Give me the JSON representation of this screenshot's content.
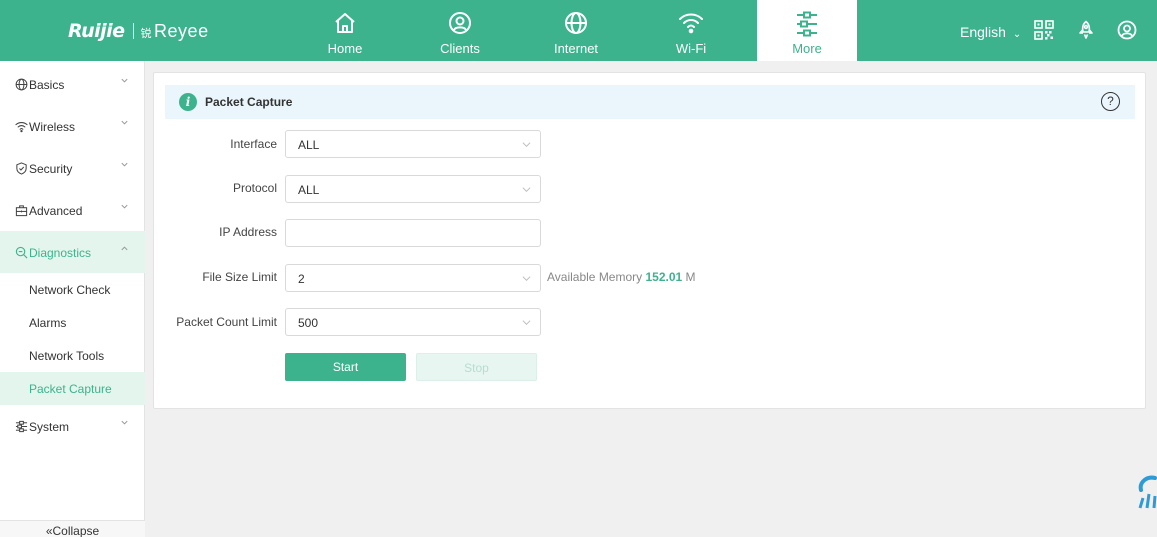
{
  "header": {
    "brand_primary": "Ruijie",
    "brand_secondary_mini": "锐",
    "brand_secondary": "Reyee",
    "nav": [
      {
        "label": "Home",
        "icon": "home-icon"
      },
      {
        "label": "Clients",
        "icon": "user-icon"
      },
      {
        "label": "Internet",
        "icon": "globe-icon"
      },
      {
        "label": "Wi-Fi",
        "icon": "wifi-icon"
      },
      {
        "label": "More",
        "icon": "sliders-icon",
        "active": true
      }
    ],
    "language": "English",
    "icons": [
      "qrcode-icon",
      "rocket-icon",
      "account-icon"
    ],
    "accent_color": "#3db38d"
  },
  "sidebar": {
    "groups": [
      {
        "label": "Basics",
        "icon": "globe-icon"
      },
      {
        "label": "Wireless",
        "icon": "wifi-icon"
      },
      {
        "label": "Security",
        "icon": "shield-icon"
      },
      {
        "label": "Advanced",
        "icon": "toolbox-icon"
      },
      {
        "label": "Diagnostics",
        "icon": "search-icon",
        "open": true
      },
      {
        "label": "System",
        "icon": "sliders-icon"
      }
    ],
    "diagnostics_items": [
      {
        "label": "Network Check"
      },
      {
        "label": "Alarms"
      },
      {
        "label": "Network Tools"
      },
      {
        "label": "Packet Capture",
        "active": true
      }
    ],
    "collapse_label": "«Collapse"
  },
  "main": {
    "title": "Packet Capture",
    "form": {
      "interface": {
        "label": "Interface",
        "value": "ALL"
      },
      "protocol": {
        "label": "Protocol",
        "value": "ALL"
      },
      "ip_address": {
        "label": "IP Address",
        "value": ""
      },
      "file_size_limit": {
        "label": "File Size Limit",
        "value": "2"
      },
      "packet_count_limit": {
        "label": "Packet Count Limit",
        "value": "500"
      }
    },
    "memory": {
      "prefix": "Available Memory",
      "value": "152.01",
      "unit": "M"
    },
    "buttons": {
      "start": "Start",
      "stop": "Stop"
    }
  }
}
